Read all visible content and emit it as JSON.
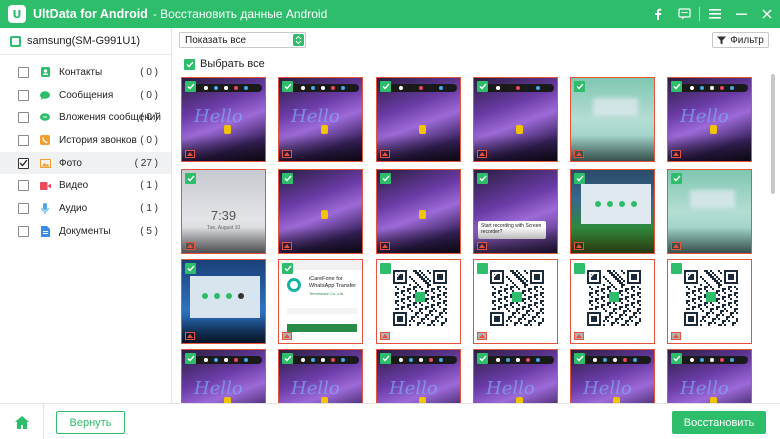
{
  "window": {
    "app_name": "UltData for Android",
    "subtitle": "- Восстановить данные Android",
    "logo_letter": "U",
    "accent_color": "#2ebd6b",
    "controls": [
      "facebook-icon",
      "feedback-icon",
      "menu-icon",
      "minimize-icon",
      "close-icon"
    ]
  },
  "sidebar": {
    "device_name": "samsung(SM-G991U1)",
    "categories": [
      {
        "label": "Контакты",
        "count": "( 0 )",
        "icon": "contacts-icon",
        "checked": false
      },
      {
        "label": "Сообщения",
        "count": "( 0 )",
        "icon": "messages-icon",
        "checked": false
      },
      {
        "label": "Вложения сообщений",
        "count": "( 0 )",
        "icon": "attachments-icon",
        "checked": false
      },
      {
        "label": "История звонков",
        "count": "( 0 )",
        "icon": "call-history-icon",
        "checked": false
      },
      {
        "label": "Фото",
        "count": "( 27 )",
        "icon": "photo-icon",
        "checked": true
      },
      {
        "label": "Видео",
        "count": "( 1 )",
        "icon": "video-icon",
        "checked": false
      },
      {
        "label": "Аудио",
        "count": "( 1 )",
        "icon": "audio-icon",
        "checked": false
      },
      {
        "label": "Документы",
        "count": "( 5 )",
        "icon": "documents-icon",
        "checked": false
      }
    ]
  },
  "toolbar": {
    "filter_select_value": "Показать все",
    "filter_button_label": "Фильтр",
    "select_all_label": "Выбрать все"
  },
  "photos": {
    "thumbnails_visible_text": {
      "hello": "Hello",
      "lock_time": "7:39",
      "lock_date": "Tue, August 10",
      "recording_card": "Start recording with Screen recorder?",
      "app_title": "iCareFone for WhatsApp Transfer",
      "app_dev": "Tenorshare Co.,Ltd."
    },
    "rows": [
      [
        "hello",
        "hello",
        "dark",
        "dark",
        "green",
        "hello"
      ],
      [
        "lock",
        "dark2",
        "dark2",
        "rec",
        "screen",
        "green"
      ],
      [
        "screen2",
        "app",
        "qr",
        "qr",
        "qr",
        "qr"
      ],
      [
        "hello",
        "hello",
        "hello",
        "hello",
        "hello",
        "hello"
      ]
    ]
  },
  "footer": {
    "back_label": "Вернуть",
    "recover_label": "Восстановить"
  }
}
